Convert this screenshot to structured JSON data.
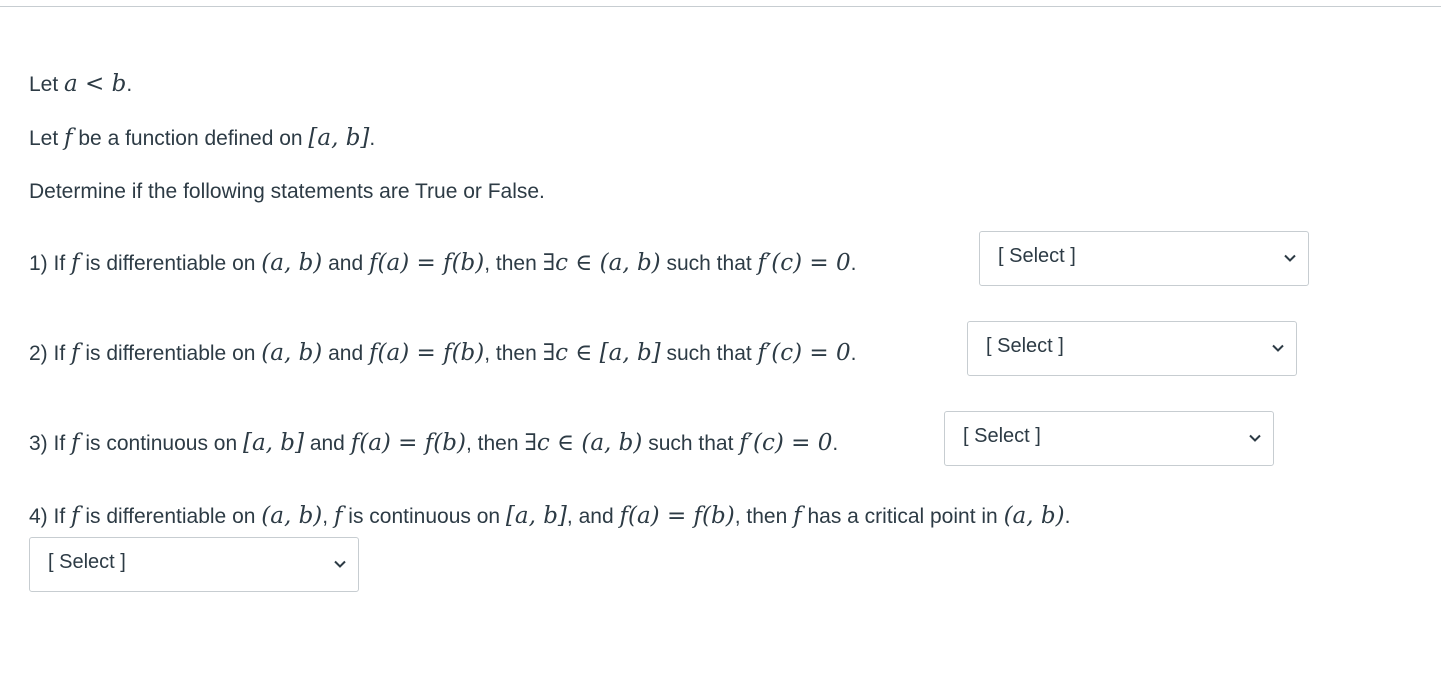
{
  "intro": {
    "line1_prefix": "Let ",
    "line1_math": "a < b",
    "line1_suffix": ".",
    "line2_prefix": "Let ",
    "line2_f": "f",
    "line2_mid": " be a function defined on ",
    "line2_interval": "[a, b]",
    "line2_suffix": ".",
    "line3": "Determine if the following statements are True or False."
  },
  "questions": [
    {
      "num": "1) If ",
      "f": "f",
      "t1": " is differentiable on ",
      "m1": "(a, b)",
      "t2": " and ",
      "m2": "f(a) = f(b)",
      "t3": ", then ",
      "m3": "∃c ∈ (a, b)",
      "t4": " such that ",
      "m4": "f′(c) = 0",
      "t5": ".",
      "select_label": "[ Select ]"
    },
    {
      "num": "2) If ",
      "f": "f",
      "t1": " is differentiable on ",
      "m1": "(a, b)",
      "t2": " and ",
      "m2": "f(a) = f(b)",
      "t3": ", then ",
      "m3": "∃c ∈ [a, b]",
      "t4": " such that ",
      "m4": "f′(c) = 0",
      "t5": ".",
      "select_label": "[ Select ]"
    },
    {
      "num": "3) If ",
      "f": "f",
      "t1": " is continuous on ",
      "m1": "[a, b]",
      "t2": " and ",
      "m2": "f(a) = f(b)",
      "t3": ", then ",
      "m3": "∃c ∈ (a, b)",
      "t4": " such that ",
      "m4": "f′(c) = 0",
      "t5": ".",
      "select_label": "[ Select ]"
    },
    {
      "num": "4) If ",
      "f": "f",
      "t1": " is differentiable on ",
      "m1": "(a, b)",
      "t2": ", ",
      "f2": "f",
      "t3": " is continuous on ",
      "m2": "[a, b]",
      "t4": ", and ",
      "m3": "f(a) = f(b)",
      "t5": ", then ",
      "f3": "f",
      "t6": " has a critical point in ",
      "m4": "(a, b)",
      "t7": ".",
      "select_label": "[ Select ]"
    }
  ],
  "icons": {
    "dropdown": "chevron-down-icon"
  }
}
